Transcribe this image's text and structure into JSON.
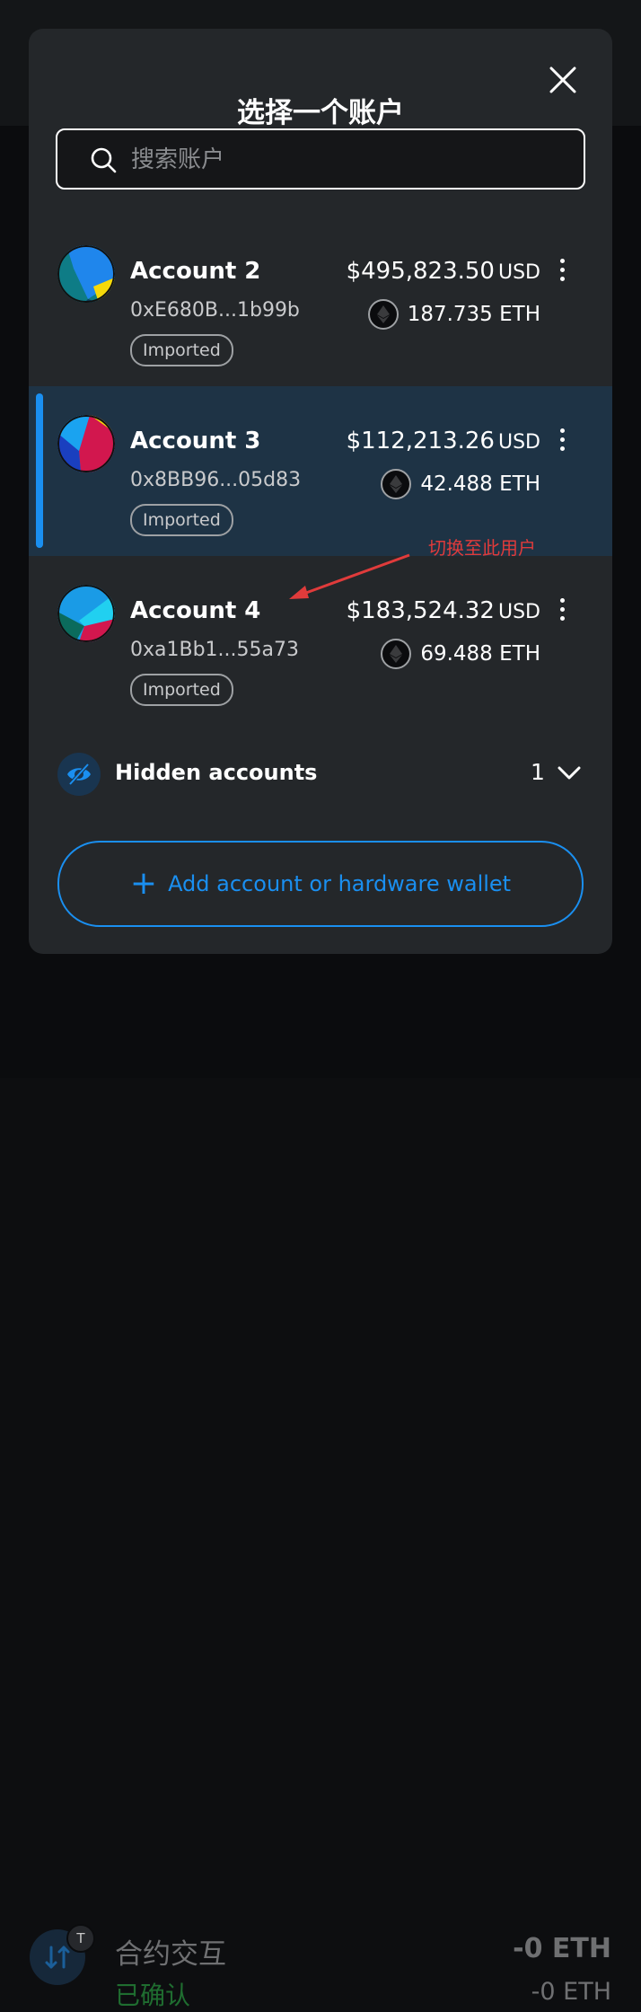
{
  "modal": {
    "title": "选择一个账户",
    "search_placeholder": "搜索账户"
  },
  "accounts": [
    {
      "name": "Account 2",
      "address": "0xE680B...1b99b",
      "tag": "Imported",
      "balance": "$495,823.50",
      "currency": "USD",
      "eth": "187.735 ETH",
      "selected": false
    },
    {
      "name": "Account 3",
      "address": "0x8BB96...05d83",
      "tag": "Imported",
      "balance": "$112,213.26",
      "currency": "USD",
      "eth": "42.488 ETH",
      "selected": true
    },
    {
      "name": "Account 4",
      "address": "0xa1Bb1...55a73",
      "tag": "Imported",
      "balance": "$183,524.32",
      "currency": "USD",
      "eth": "69.488 ETH",
      "selected": false
    }
  ],
  "hidden": {
    "label": "Hidden accounts",
    "count": "1"
  },
  "add_button": {
    "label": "Add account or hardware wallet"
  },
  "annotation": {
    "text": "切换至此用户",
    "color": "#e03b3b"
  },
  "background_tx": {
    "badge": "T",
    "title": "合约交互",
    "status": "已确认",
    "amount_primary": "-0 ETH",
    "amount_secondary": "-0 ETH"
  },
  "colors": {
    "accent": "#1a8ff0",
    "modal_bg": "#24272a",
    "selected_bg": "#1e3345"
  }
}
